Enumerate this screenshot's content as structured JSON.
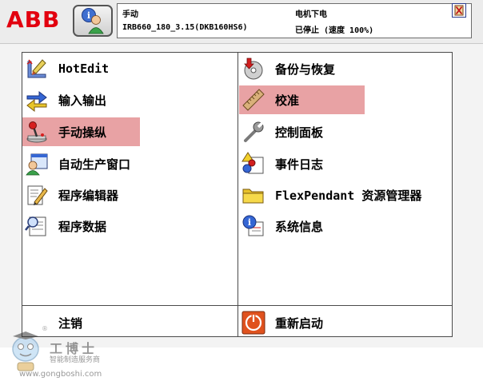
{
  "header": {
    "logo": "ABB",
    "mode": "手动",
    "controller": "IRB660_180_3.15(DKB160HS6)",
    "motor_state": "电机下电",
    "run_state": "已停止 (速度 100%)"
  },
  "left_menu": [
    {
      "label": "HotEdit",
      "icon": "hotedit-icon",
      "selected": false
    },
    {
      "label": "输入输出",
      "icon": "io-arrows-icon",
      "selected": false
    },
    {
      "label": "手动操纵",
      "icon": "joystick-icon",
      "selected": true
    },
    {
      "label": "自动生产窗口",
      "icon": "auto-production-icon",
      "selected": false
    },
    {
      "label": "程序编辑器",
      "icon": "program-editor-icon",
      "selected": false
    },
    {
      "label": "程序数据",
      "icon": "program-data-icon",
      "selected": false
    }
  ],
  "right_menu": [
    {
      "label": "备份与恢复",
      "icon": "backup-disc-icon",
      "selected": false
    },
    {
      "label": "校准",
      "icon": "calibration-ruler-icon",
      "selected": true
    },
    {
      "label": "控制面板",
      "icon": "wrench-icon",
      "selected": false
    },
    {
      "label": "事件日志",
      "icon": "event-log-icon",
      "selected": false
    },
    {
      "label": "FlexPendant 资源管理器",
      "icon": "folder-icon",
      "selected": false
    },
    {
      "label": "系统信息",
      "icon": "system-info-icon",
      "selected": false
    }
  ],
  "bottom": {
    "logout_label": "注销",
    "restart_label": "重新启动"
  },
  "watermark": {
    "name": "工博士",
    "subtitle": "智能制造服务商",
    "url": "www.gongboshi.com",
    "registered": "®"
  },
  "colors": {
    "selected": "#e8a2a4",
    "brand_red": "#e2000f"
  }
}
